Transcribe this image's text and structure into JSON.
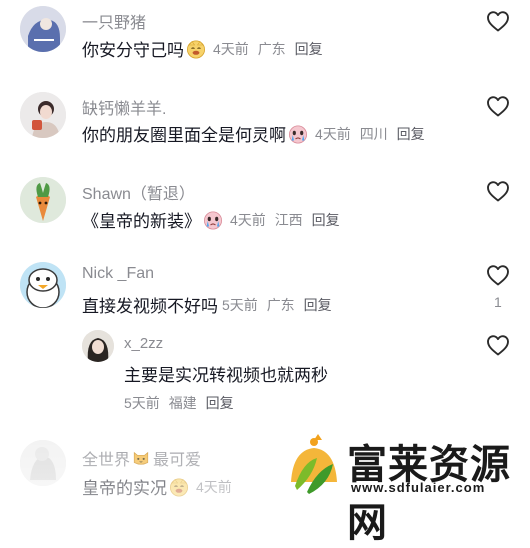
{
  "comments": [
    {
      "username": "一只野猪",
      "text": "你安分守己吗",
      "emoji": "smirk-emoji",
      "time": "4天前",
      "location": "广东",
      "reply": "回复"
    },
    {
      "username": "缺钙懒羊羊.",
      "text": "你的朋友圈里面全是何灵啊",
      "emoji": "crying-emoji",
      "time": "4天前",
      "location": "四川",
      "reply": "回复"
    },
    {
      "username": "Shawn（暂退）",
      "text": "《皇帝的新装》",
      "emoji": "crying-emoji",
      "time": "4天前",
      "location": "江西",
      "reply": "回复"
    },
    {
      "username": "Nick _Fan",
      "text": "直接发视频不好吗",
      "time": "5天前",
      "location": "广东",
      "reply": "回复",
      "likes": "1",
      "replies": [
        {
          "username": "x_2zz",
          "text": "主要是实况转视频也就两秒",
          "time": "5天前",
          "location": "福建",
          "reply": "回复"
        }
      ]
    },
    {
      "username": "全世界",
      "username_suffix": "最可爱",
      "username_emoji": "cat-emoji",
      "text": "皇帝的实况",
      "emoji": "smirk-emoji",
      "time": "4天前"
    }
  ],
  "watermark": {
    "title": "富莱资源网",
    "url": "www.sdfulaier.com"
  },
  "colors": {
    "primary_text": "#161823",
    "secondary_text": "#8a8b91",
    "heart_outline": "#2b2b2b"
  }
}
